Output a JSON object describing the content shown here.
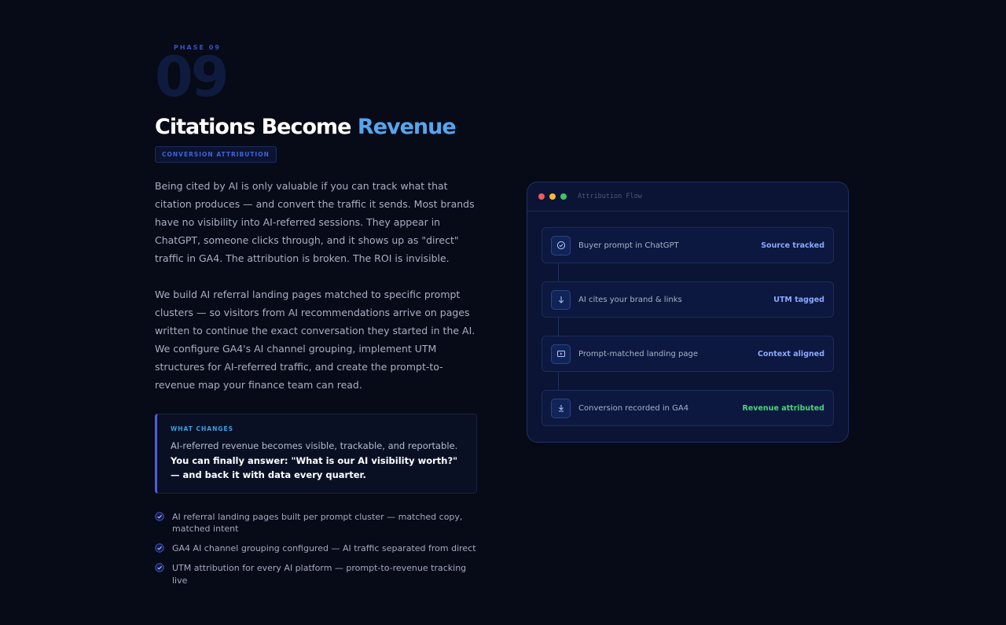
{
  "phase": {
    "label": "PHASE 09",
    "number": "09"
  },
  "headline": {
    "main": "Citations Become ",
    "accent": "Revenue"
  },
  "badge": "CONVERSION ATTRIBUTION",
  "paragraphs": [
    "Being cited by AI is only valuable if you can track what that citation produces — and convert the traffic it sends. Most brands have no visibility into AI-referred sessions. They appear in ChatGPT, someone clicks through, and it shows up as \"direct\" traffic in GA4. The attribution is broken. The ROI is invisible.",
    "We build AI referral landing pages matched to specific prompt clusters — so visitors from AI recommendations arrive on pages written to continue the exact conversation they started in the AI. We configure GA4's AI channel grouping, implement UTM structures for AI-referred traffic, and create the prompt-to-revenue map your finance team can read."
  ],
  "callout": {
    "title": "WHAT CHANGES",
    "text": "AI-referred revenue becomes visible, trackable, and reportable.",
    "strong": "You can finally answer: \"What is our AI visibility worth?\" — and back it with data every quarter."
  },
  "checklist": [
    "AI referral landing pages built per prompt cluster — matched copy, matched intent",
    "GA4 AI channel grouping configured — AI traffic separated from direct",
    "UTM attribution for every AI platform — prompt-to-revenue tracking live"
  ],
  "flow_card": {
    "title": "Attribution Flow",
    "dots": [
      "#ee5a5a",
      "#f2b93b",
      "#3cc46a"
    ],
    "steps": [
      {
        "icon": "check-circle-icon",
        "label": "Buyer prompt in ChatGPT",
        "status": "Source tracked",
        "status_color": "#8ba8ff"
      },
      {
        "icon": "arrow-down-icon",
        "label": "AI cites your brand & links",
        "status": "UTM tagged",
        "status_color": "#8ba8ff"
      },
      {
        "icon": "page-icon",
        "label": "Prompt-matched landing page",
        "status": "Context aligned",
        "status_color": "#8ba8ff"
      },
      {
        "icon": "download-icon",
        "label": "Conversion recorded in GA4",
        "status": "Revenue attributed",
        "status_color": "#4cd37a"
      }
    ]
  },
  "colors": {
    "background": "#070a17",
    "accent": "#56a6ee",
    "card_bg": "#0b1434"
  }
}
